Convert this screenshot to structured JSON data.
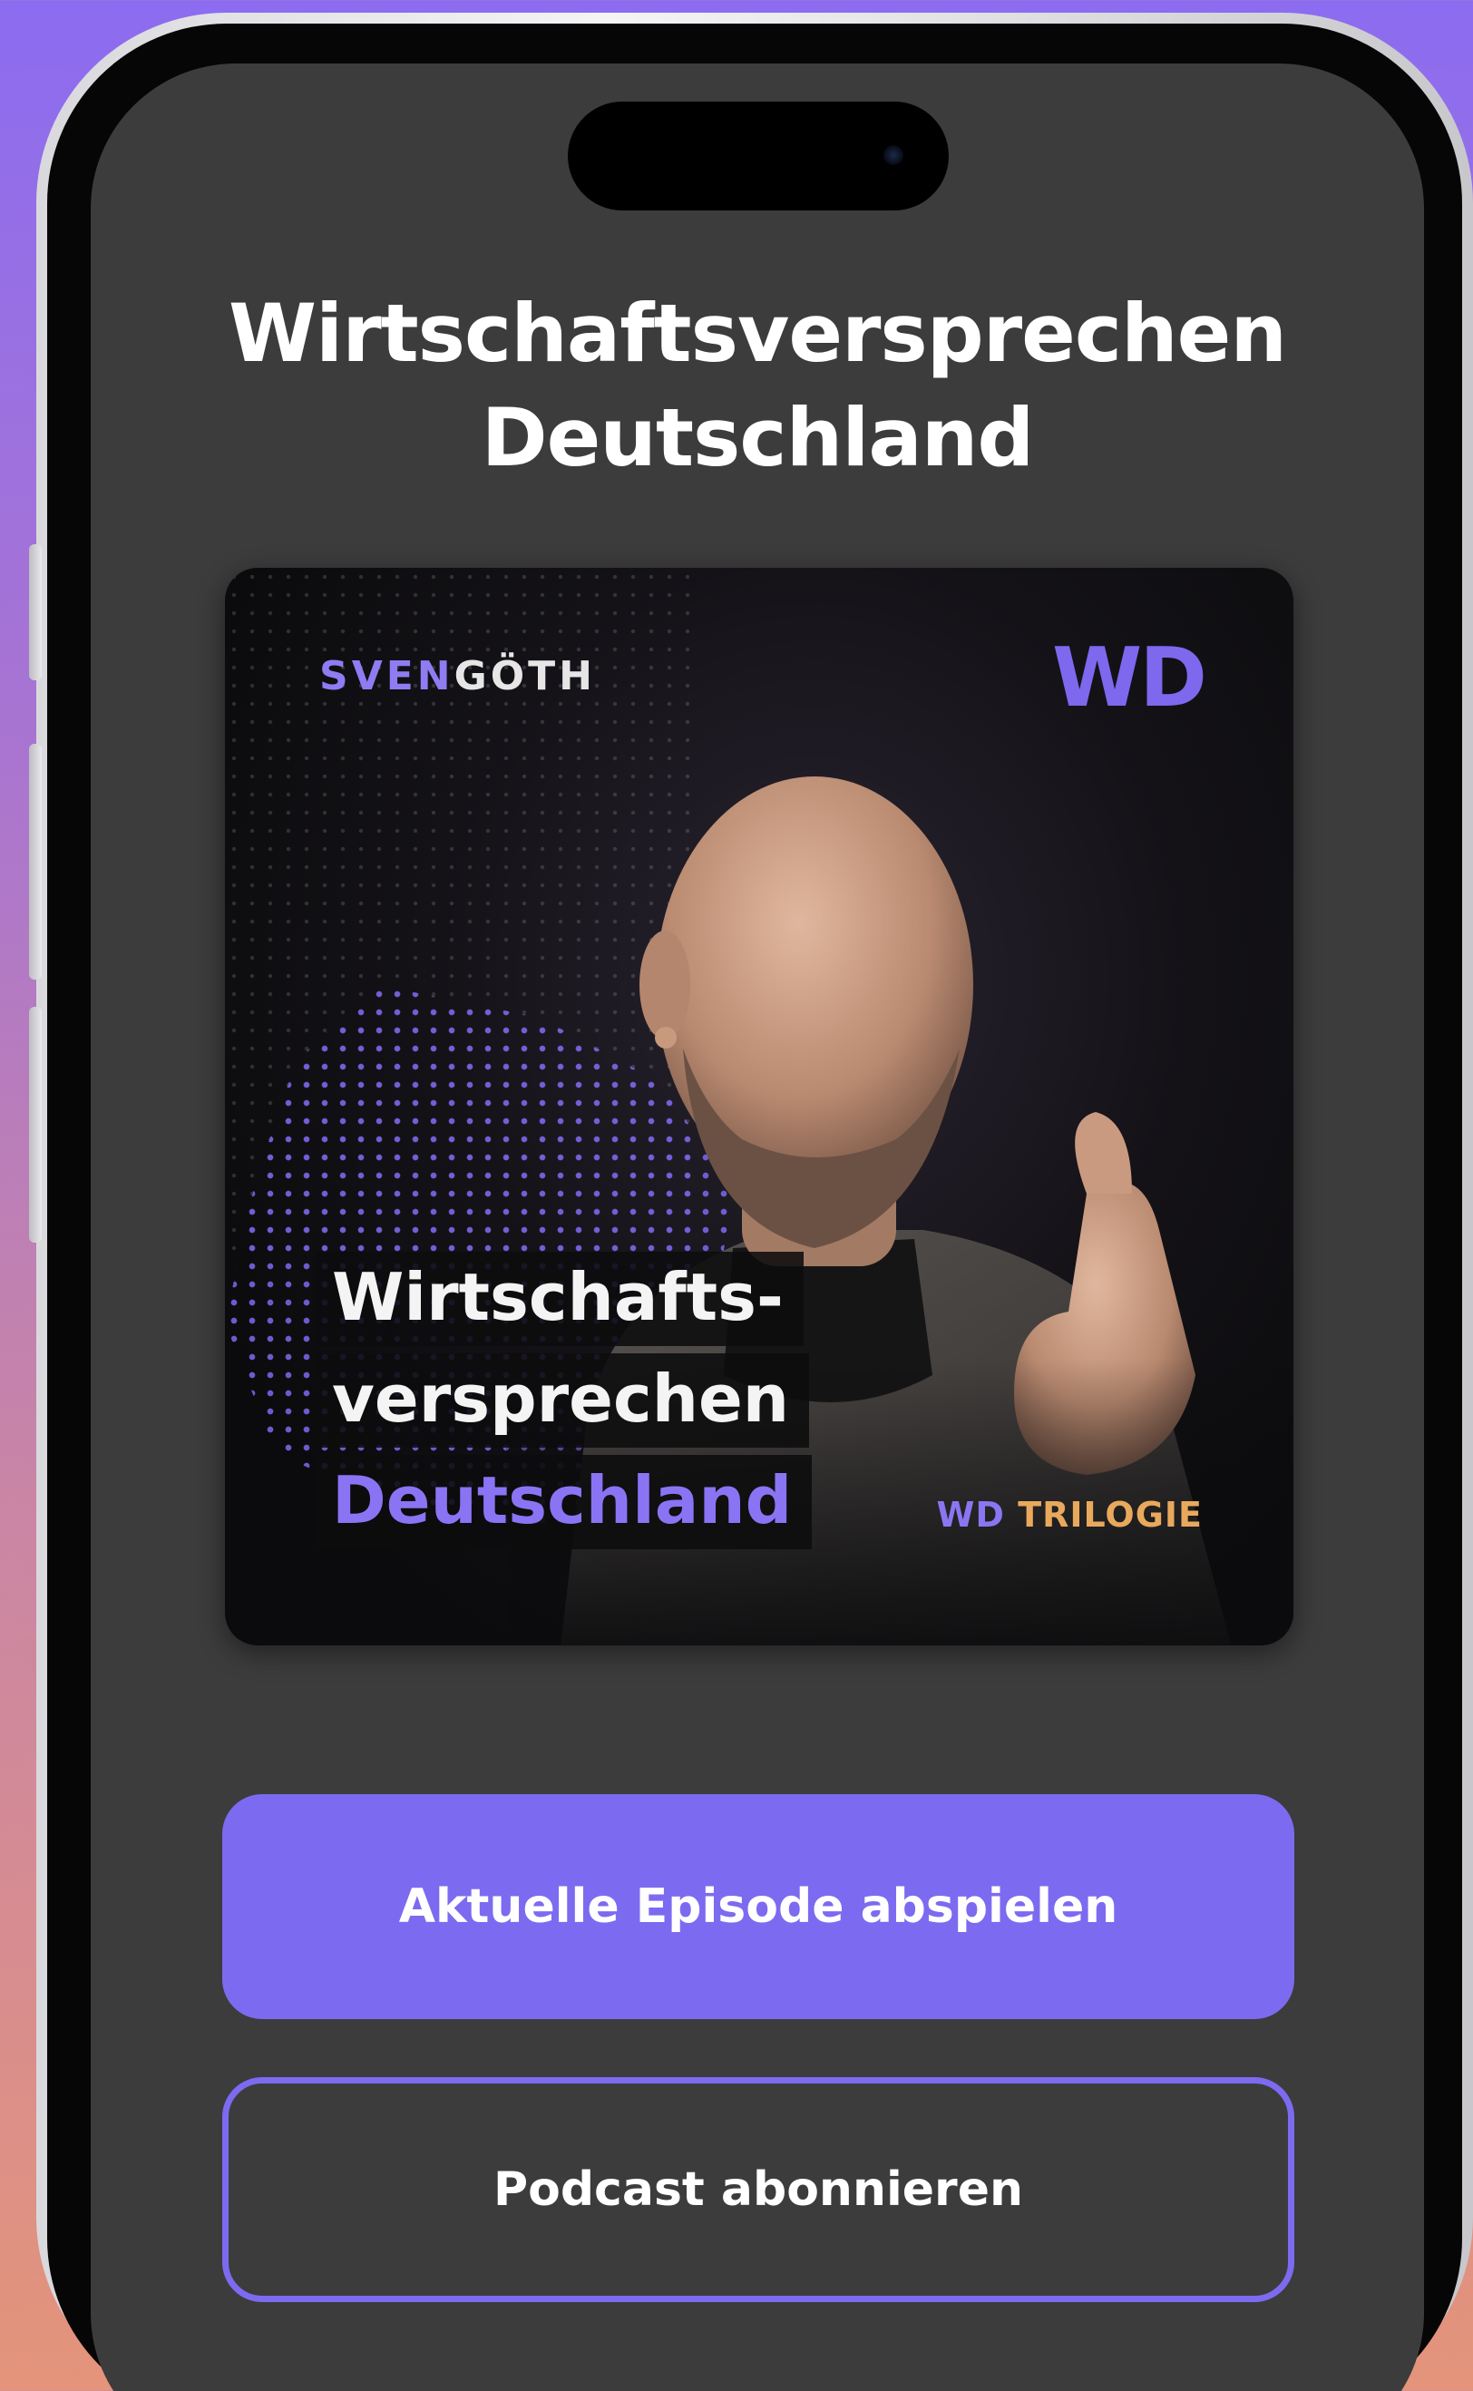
{
  "page": {
    "title_lines": [
      "Wirtschaftsversprechen",
      "Deutschland"
    ]
  },
  "cover": {
    "author_first": "SVEN",
    "author_last": "GÖTH",
    "logo": "WD",
    "title_lines": [
      "Wirtschafts-",
      "versprechen",
      "Deutschland"
    ],
    "series_prefix": "WD",
    "series_name": "TRILOGIE"
  },
  "actions": {
    "play_label": "Aktuelle Episode abspielen",
    "subscribe_label": "Podcast abonnieren"
  },
  "colors": {
    "accent": "#7c6bf0",
    "screen_background": "#3c3c3c",
    "series_highlight": "#e9a95d"
  }
}
